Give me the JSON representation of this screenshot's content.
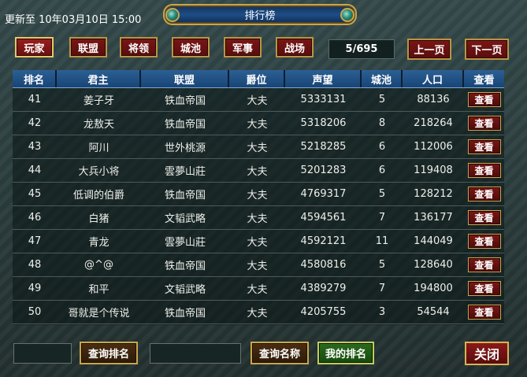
{
  "header": {
    "updated_text": "更新至 10年03月10日 15:00",
    "title": "排行榜"
  },
  "tabs": [
    {
      "label": "玩家",
      "active": true
    },
    {
      "label": "联盟",
      "active": false
    },
    {
      "label": "将领",
      "active": false
    },
    {
      "label": "城池",
      "active": false
    },
    {
      "label": "军事",
      "active": false
    },
    {
      "label": "战场",
      "active": false
    }
  ],
  "pagination": {
    "page_text": "5/695",
    "prev_label": "上一页",
    "next_label": "下一页"
  },
  "table": {
    "columns": [
      "排名",
      "君主",
      "联盟",
      "爵位",
      "声望",
      "城池",
      "人口",
      "查看"
    ],
    "rows": [
      {
        "rank": "41",
        "lord": "姜子牙",
        "alliance": "铁血帝国",
        "title": "大夫",
        "prestige": "5333131",
        "cities": "5",
        "population": "88136",
        "view": "查看"
      },
      {
        "rank": "42",
        "lord": "龙敖天",
        "alliance": "铁血帝国",
        "title": "大夫",
        "prestige": "5318206",
        "cities": "8",
        "population": "218264",
        "view": "查看"
      },
      {
        "rank": "43",
        "lord": "阿川",
        "alliance": "世外桃源",
        "title": "大夫",
        "prestige": "5218285",
        "cities": "6",
        "population": "112006",
        "view": "查看"
      },
      {
        "rank": "44",
        "lord": "大兵小将",
        "alliance": "雲夢山莊",
        "title": "大夫",
        "prestige": "5201283",
        "cities": "6",
        "population": "119408",
        "view": "查看"
      },
      {
        "rank": "45",
        "lord": "低调的伯爵",
        "alliance": "铁血帝国",
        "title": "大夫",
        "prestige": "4769317",
        "cities": "5",
        "population": "128212",
        "view": "查看"
      },
      {
        "rank": "46",
        "lord": "白猪",
        "alliance": "文韬武略",
        "title": "大夫",
        "prestige": "4594561",
        "cities": "7",
        "population": "136177",
        "view": "查看"
      },
      {
        "rank": "47",
        "lord": "青龙",
        "alliance": "雲夢山莊",
        "title": "大夫",
        "prestige": "4592121",
        "cities": "11",
        "population": "144049",
        "view": "查看"
      },
      {
        "rank": "48",
        "lord": "@^@",
        "alliance": "铁血帝国",
        "title": "大夫",
        "prestige": "4580816",
        "cities": "5",
        "population": "128640",
        "view": "查看"
      },
      {
        "rank": "49",
        "lord": "和平",
        "alliance": "文韬武略",
        "title": "大夫",
        "prestige": "4389279",
        "cities": "7",
        "population": "194800",
        "view": "查看"
      },
      {
        "rank": "50",
        "lord": "哥就是个传说",
        "alliance": "铁血帝国",
        "title": "大夫",
        "prestige": "4205755",
        "cities": "3",
        "population": "54544",
        "view": "查看"
      }
    ]
  },
  "footer": {
    "rank_input_value": "",
    "query_rank_label": "查询排名",
    "name_input_value": "",
    "query_name_label": "查询名称",
    "my_rank_label": "我的排名",
    "close_label": "关闭"
  },
  "colors": {
    "accent_gold": "#c9a64a",
    "button_red": "#7a1616",
    "header_blue": "#2c5f93",
    "my_rank_green": "#2c6a1e"
  }
}
